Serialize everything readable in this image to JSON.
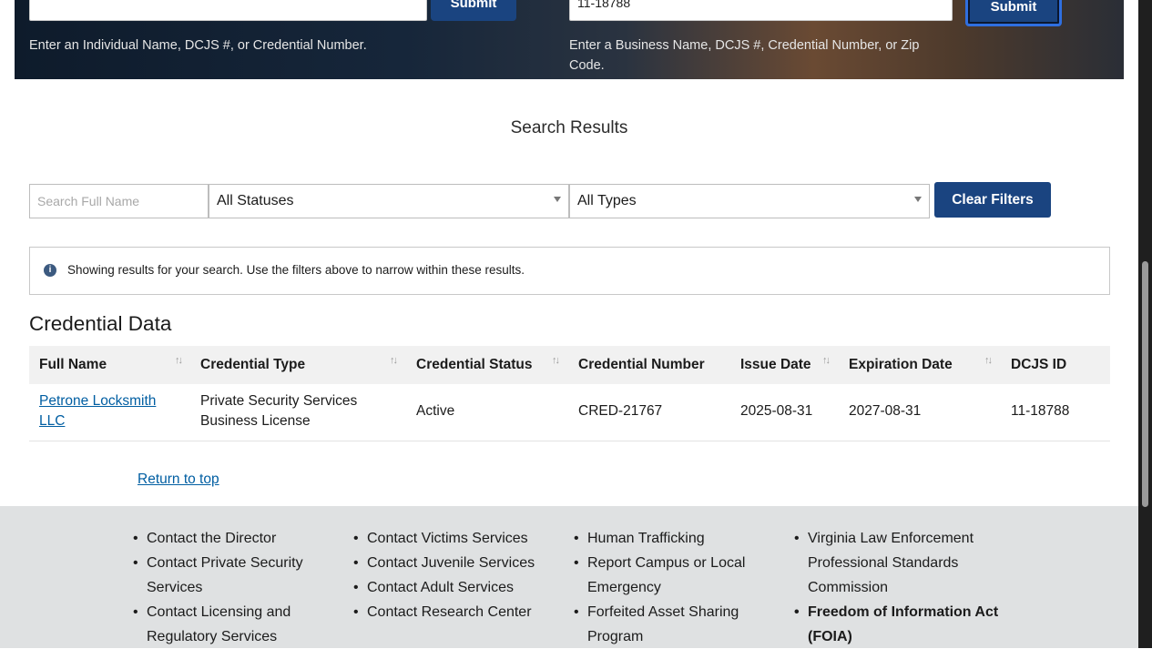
{
  "hero": {
    "individual_input_value": "",
    "individual_submit_label": "Submit",
    "individual_help": "Enter an Individual Name, DCJS #, or Credential Number.",
    "business_input_value": "11-18788",
    "business_submit_label": "Submit",
    "business_help": "Enter a Business Name, DCJS #, Credential Number, or Zip Code."
  },
  "results": {
    "title": "Search Results",
    "filters": {
      "name_placeholder": "Search Full Name",
      "status_selected": "All Statuses",
      "type_selected": "All Types",
      "clear_label": "Clear Filters"
    },
    "alert": {
      "icon": "info-icon",
      "message": "Showing results for your search. Use the filters above to narrow within these results."
    },
    "section_title": "Credential Data",
    "table": {
      "headers": [
        "Full Name",
        "Credential Type",
        "Credential Status",
        "Credential Number",
        "Issue Date",
        "Expiration Date",
        "DCJS ID"
      ],
      "rows": [
        {
          "full_name": "Petrone Locksmith LLC",
          "credential_type": "Private Security Services Business License",
          "status": "Active",
          "credential_number": "CRED-21767",
          "issue_date": "2025-08-31",
          "expiration_date": "2027-08-31",
          "dcjs_id": "11-18788"
        }
      ]
    },
    "return_to_top": "Return to top"
  },
  "footer": {
    "col1": [
      "Contact the Director",
      "Contact Private Security Services",
      "Contact Licensing and Regulatory Services"
    ],
    "col2": [
      "Contact Victims Services",
      "Contact Juvenile Services",
      "Contact Adult Services",
      "Contact Research Center"
    ],
    "col3": [
      "Human Trafficking",
      "Report Campus or Local Emergency",
      "Forfeited Asset Sharing Program"
    ],
    "col4": [
      "Virginia Law Enforcement Professional Standards Commission",
      "Freedom of Information Act (FOIA)"
    ]
  },
  "colors": {
    "primary_button": "#1a4480",
    "link": "#005ea2",
    "footer_bg": "#dfe1e2"
  }
}
